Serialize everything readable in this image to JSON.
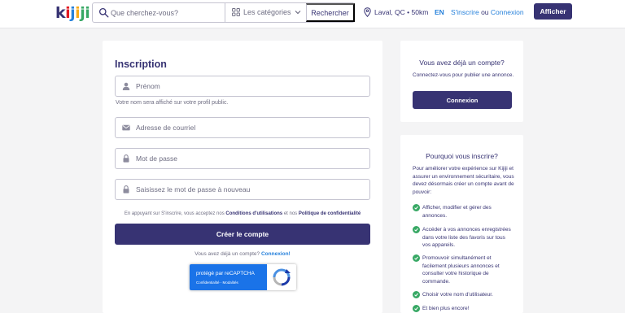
{
  "header": {
    "logo_text": "kijiji",
    "search_placeholder": "Que cherchez-vous?",
    "category_label": "Les catégories",
    "search_button": "Rechercher",
    "location": "Laval, QC • 50km",
    "language": "EN",
    "signup_link": "S'inscrire",
    "or_text": "ou",
    "login_link": "Connexion",
    "post_button": "Afficher"
  },
  "form": {
    "title": "Inscription",
    "first_name_placeholder": "Prénom",
    "name_hint": "Votre nom sera affiché sur votre profil public.",
    "email_placeholder": "Adresse de courriel",
    "password_placeholder": "Mot de passe",
    "confirm_placeholder": "Saisissez le mot de passe à nouveau",
    "terms_prefix": "En appuyant sur S'inscrire, vous acceptez nos",
    "terms_link": "Conditions d'utilisations",
    "terms_mid": "et nos",
    "privacy_link": "Politique de confidentialité",
    "create_button": "Créer le compte",
    "have_account_text": "Vous avez déjà un compte?",
    "have_account_link": "Connexion!"
  },
  "recaptcha": {
    "title": "protégé par reCAPTCHA",
    "links": "Confidentialité - Modalités"
  },
  "side_login": {
    "title": "Vous avez déjà un compte?",
    "text": "Connectez-vous pour publier une annonce.",
    "button": "Connexion"
  },
  "side_why": {
    "title": "Pourquoi vous inscrire?",
    "intro": "Pour améliorer votre expérience sur Kijiji et assurer un environnement sécuritaire, vous devez désormais créer un compte avant de pouvoir:",
    "benefits": [
      "Afficher, modifier et gérer des annonces.",
      "Accéder à vos annonces enregistrées dans votre liste des favoris sur tous vos appareils.",
      "Promouvoir simultanément et facilement plusieurs annonces et consulter votre historique de commande.",
      "Choisir votre nom d'utilisateur.",
      "Et bien plus encore!"
    ]
  },
  "colors": {
    "brand_navy": "#373373",
    "link_blue": "#2681db",
    "check_green": "#37a864",
    "page_bg": "#f4f4f5"
  }
}
